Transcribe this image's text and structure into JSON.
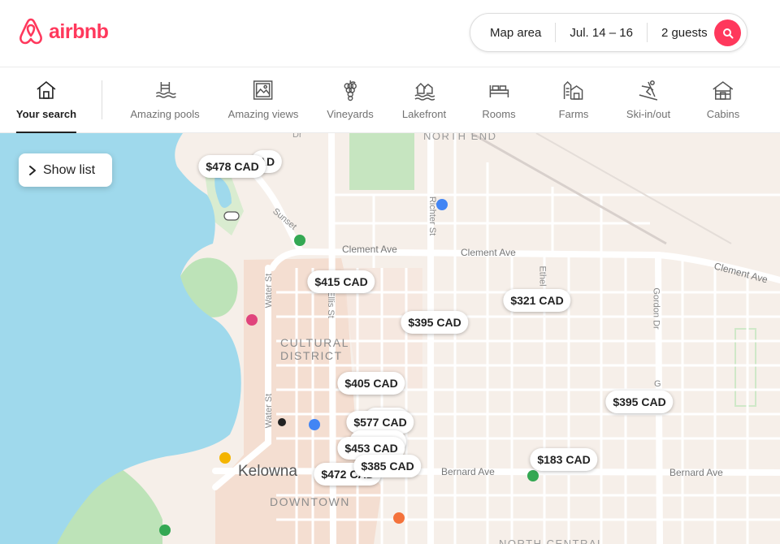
{
  "header": {
    "logo_text": "airbnb",
    "search": {
      "location": "Map area",
      "dates": "Jul. 14 – 16",
      "guests": "2 guests"
    }
  },
  "categories": [
    {
      "label": "Your search",
      "icon": "home-search-icon",
      "active": true
    },
    {
      "label": "Amazing pools",
      "icon": "pool-icon"
    },
    {
      "label": "Amazing views",
      "icon": "picture-frame-icon"
    },
    {
      "label": "Vineyards",
      "icon": "grapes-icon"
    },
    {
      "label": "Lakefront",
      "icon": "lakefront-icon"
    },
    {
      "label": "Rooms",
      "icon": "bed-icon"
    },
    {
      "label": "Farms",
      "icon": "barn-icon"
    },
    {
      "label": "Ski-in/out",
      "icon": "skier-icon"
    },
    {
      "label": "Cabins",
      "icon": "cabin-icon"
    }
  ],
  "map": {
    "show_list_label": "Show list",
    "price_pins": [
      {
        "label": "$478 CAD"
      },
      {
        "label": "AD"
      },
      {
        "label": "$415 CAD"
      },
      {
        "label": "$321 CAD"
      },
      {
        "label": "$395 CAD"
      },
      {
        "label": "$405 CAD"
      },
      {
        "label": "$395 CAD"
      },
      {
        "label": "$577 CAD"
      },
      {
        "label": "$453 CAD"
      },
      {
        "label": "$183 CAD"
      },
      {
        "label": "$385 CAD"
      },
      {
        "label": "$472 CAD"
      }
    ],
    "labels": {
      "north_end": "NORTH END",
      "clement_1": "Clement Ave",
      "clement_2": "Clement Ave",
      "clement_3": "Clement Ave",
      "cultural_1": "CULTURAL",
      "cultural_2": "DISTRICT",
      "kelowna": "Kelowna",
      "downtown": "DOWNTOWN",
      "bernard_1": "Bernard Ave",
      "bernard_2": "Bernard Ave",
      "water_1": "Water St",
      "water_2": "Water St",
      "ellis": "Ellis St",
      "richter": "Richter St",
      "ethel": "Ethel",
      "gordon": "Gordon Dr",
      "gordon2": "G",
      "sunset": "Sunset",
      "north_central": "NORTH CENTRAL",
      "top_dr": "Dr"
    },
    "colors": {
      "water": "#9fd9ec",
      "land": "#f6efe9",
      "downtown": "#f3d8c8",
      "park": "#bde3b8",
      "road": "#ffffff"
    }
  },
  "colors": {
    "brand": "#ff385c"
  }
}
